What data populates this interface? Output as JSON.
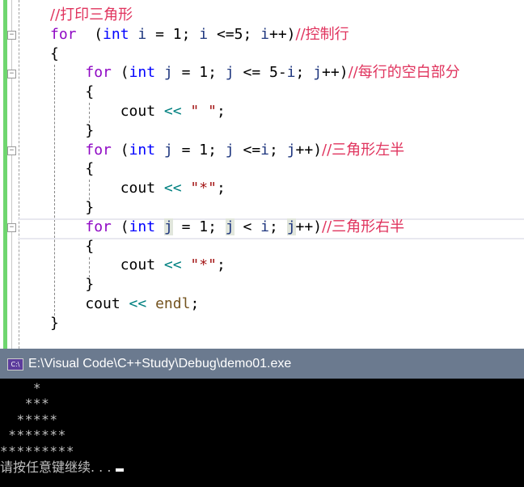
{
  "editor": {
    "lines": [
      [
        [
          "cm",
          "//打印三角形"
        ]
      ],
      [
        [
          "kw",
          "for"
        ],
        [
          "",
          "  ("
        ],
        [
          "ty",
          "int"
        ],
        [
          "",
          " "
        ],
        [
          "va",
          "i"
        ],
        [
          "",
          " = 1; "
        ],
        [
          "va",
          "i"
        ],
        [
          "",
          " <=5; "
        ],
        [
          "va",
          "i"
        ],
        [
          "",
          "++)"
        ],
        [
          "cm",
          "//控制行"
        ]
      ],
      [
        [
          "",
          "{"
        ]
      ],
      [
        [
          "",
          "    "
        ],
        [
          "kw",
          "for"
        ],
        [
          "",
          " ("
        ],
        [
          "ty",
          "int"
        ],
        [
          "",
          " "
        ],
        [
          "va",
          "j"
        ],
        [
          "",
          " = 1; "
        ],
        [
          "va",
          "j"
        ],
        [
          "",
          " <= 5-"
        ],
        [
          "va",
          "i"
        ],
        [
          "",
          "; "
        ],
        [
          "va",
          "j"
        ],
        [
          "",
          "++)"
        ],
        [
          "cm",
          "//每行的空白部分"
        ]
      ],
      [
        [
          "",
          "    {"
        ]
      ],
      [
        [
          "",
          "        cout "
        ],
        [
          "op",
          "<<"
        ],
        [
          "",
          " "
        ],
        [
          "st",
          "\" \""
        ],
        [
          "",
          ";"
        ]
      ],
      [
        [
          "",
          "    }"
        ]
      ],
      [
        [
          "",
          "    "
        ],
        [
          "kw",
          "for"
        ],
        [
          "",
          " ("
        ],
        [
          "ty",
          "int"
        ],
        [
          "",
          " "
        ],
        [
          "va",
          "j"
        ],
        [
          "",
          " = 1; "
        ],
        [
          "va",
          "j"
        ],
        [
          "",
          " <="
        ],
        [
          "va",
          "i"
        ],
        [
          "",
          "; "
        ],
        [
          "va",
          "j"
        ],
        [
          "",
          "++)"
        ],
        [
          "cm",
          "//三角形左半"
        ]
      ],
      [
        [
          "",
          "    {"
        ]
      ],
      [
        [
          "",
          "        cout "
        ],
        [
          "op",
          "<<"
        ],
        [
          "",
          " "
        ],
        [
          "st",
          "\"*\""
        ],
        [
          "",
          ";"
        ]
      ],
      [
        [
          "",
          "    }"
        ]
      ],
      [
        [
          "",
          "    "
        ],
        [
          "kw",
          "for"
        ],
        [
          "",
          " ("
        ],
        [
          "ty",
          "int"
        ],
        [
          "",
          " "
        ],
        [
          "va hl",
          "j"
        ],
        [
          "",
          " = 1; "
        ],
        [
          "va hl",
          "j"
        ],
        [
          "",
          " < "
        ],
        [
          "va",
          "i"
        ],
        [
          "",
          "; "
        ],
        [
          "va hl",
          "j"
        ],
        [
          "",
          "++)"
        ],
        [
          "cm",
          "//三角形右半"
        ]
      ],
      [
        [
          "",
          "    {"
        ]
      ],
      [
        [
          "",
          "        cout "
        ],
        [
          "op",
          "<<"
        ],
        [
          "",
          " "
        ],
        [
          "st",
          "\"*\""
        ],
        [
          "",
          ";"
        ]
      ],
      [
        [
          "",
          "    }"
        ]
      ],
      [
        [
          "",
          "    cout "
        ],
        [
          "op",
          "<<"
        ],
        [
          "",
          " "
        ],
        [
          "fn",
          "endl"
        ],
        [
          "",
          ";"
        ]
      ],
      [
        [
          "",
          "}"
        ]
      ]
    ]
  },
  "console": {
    "title": "E:\\Visual Code\\C++Study\\Debug\\demo01.exe",
    "icon": "console-app-icon",
    "icon_text": "C:\\",
    "output": [
      "    *",
      "   ***",
      "  *****",
      " *******",
      "*********"
    ],
    "prompt": "请按任意键继续. . ."
  }
}
